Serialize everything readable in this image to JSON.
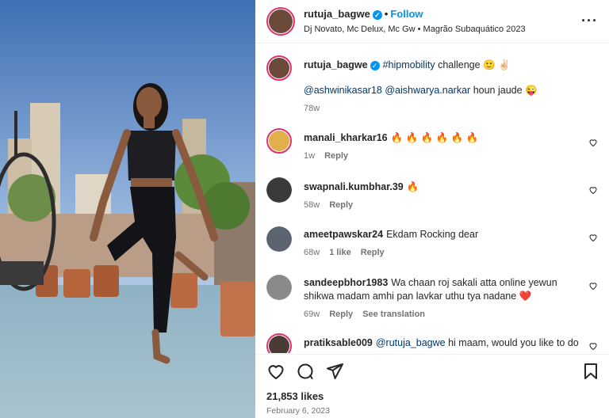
{
  "post": {
    "author": "rutuja_bagwe",
    "follow_label": "Follow",
    "audio": "Dj Novato, Mc Delux, Mc Gw • Magrão Subaquático 2023",
    "likes": "21,853 likes",
    "date": "February 6, 2023"
  },
  "caption": {
    "user": "rutuja_bagwe",
    "hashtag": "#hipmobility",
    "text": " challenge 🙂 ✌🏻",
    "mention1": "@ashwinikasar18",
    "mention2": "@aishwarya.narkar",
    "mention_text": " houn jaude 😜",
    "time": "78w"
  },
  "comments": [
    {
      "user": "manali_kharkar16",
      "text": "🔥 🔥 🔥 🔥 🔥 🔥",
      "time": "1w",
      "reply": "Reply",
      "avatar_color": "#e2b04a"
    },
    {
      "user": "swapnali.kumbhar.39",
      "text": "🔥",
      "time": "58w",
      "reply": "Reply",
      "avatar_color": "#3a3a3a"
    },
    {
      "user": "ameetpawskar24",
      "text": "Ekdam Rocking dear",
      "time": "68w",
      "likes": "1 like",
      "reply": "Reply",
      "avatar_color": "#5b6470"
    },
    {
      "user": "sandeepbhor1983",
      "text": "Wa chaan roj sakali atta online yewun shikwa madam amhi pan lavkar uthu tya nadane ❤️",
      "time": "69w",
      "reply": "Reply",
      "translate": "See translation",
      "avatar_color": "#8a8a8a"
    },
    {
      "user": "pratiksable009",
      "mention": "@rutuja_bagwe",
      "text": " hi maam, would you like to do",
      "avatar_color": "#4a3b36"
    }
  ],
  "icons": {
    "like": "heart-icon",
    "comment": "comment-bubble-icon",
    "share": "paper-plane-icon",
    "save": "bookmark-icon",
    "more": "more-options-icon",
    "verified": "verified-badge-icon"
  },
  "colors": {
    "accent": "#0095f6",
    "link": "#00376b",
    "story_ring": "#e1306c"
  }
}
